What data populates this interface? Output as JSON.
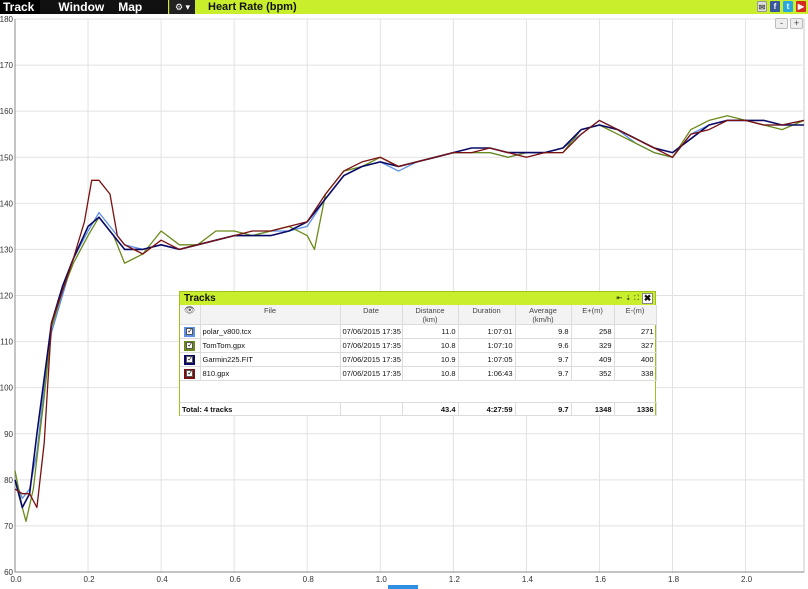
{
  "menu": {
    "track": "Track",
    "window": "Window",
    "map": "Map",
    "gear": "⚙ ▾"
  },
  "chart_title": "Heart Rate (bpm)",
  "zoom": {
    "minus": "-",
    "plus": "+"
  },
  "colors": {
    "accent": "#c8ee2c",
    "polar": "#5b8fe8",
    "tomtom": "#6b8a1a",
    "garmin": "#0a0a66",
    "suunto": "#7a1010"
  },
  "chart_data": {
    "type": "line",
    "title": "Heart Rate (bpm)",
    "xlim": [
      0.0,
      2.16
    ],
    "ylim": [
      60,
      180
    ],
    "xticks": [
      "0.0",
      "0.2",
      "0.4",
      "0.6",
      "0.8",
      "1.0",
      "1.2",
      "1.4",
      "1.6",
      "1.8",
      "2.0"
    ],
    "yticks": [
      "60",
      "70",
      "80",
      "90",
      "100",
      "110",
      "120",
      "130",
      "140",
      "150",
      "160",
      "170",
      "180"
    ],
    "grid": true,
    "series": [
      {
        "name": "polar_v800.tcx",
        "color": "#5b8fe8",
        "x": [
          0,
          0.02,
          0.04,
          0.06,
          0.08,
          0.1,
          0.13,
          0.16,
          0.2,
          0.23,
          0.27,
          0.3,
          0.35,
          0.4,
          0.45,
          0.5,
          0.55,
          0.6,
          0.65,
          0.7,
          0.75,
          0.8,
          0.85,
          0.9,
          0.95,
          1.0,
          1.05,
          1.1,
          1.15,
          1.2,
          1.25,
          1.3,
          1.35,
          1.4,
          1.45,
          1.5,
          1.55,
          1.6,
          1.65,
          1.7,
          1.75,
          1.8,
          1.85,
          1.9,
          1.95,
          2.0,
          2.05,
          2.1,
          2.16
        ],
        "y": [
          80,
          76,
          78,
          86,
          100,
          112,
          120,
          128,
          134,
          138,
          134,
          131,
          130,
          131,
          130,
          131,
          132,
          133,
          133,
          134,
          134,
          135,
          141,
          146,
          148,
          149,
          147,
          149,
          150,
          151,
          151,
          151,
          150,
          151,
          151,
          152,
          155,
          158,
          156,
          153,
          151,
          150,
          155,
          157,
          158,
          158,
          157,
          157,
          158
        ]
      },
      {
        "name": "TomTom.gpx",
        "color": "#6b8a1a",
        "x": [
          0,
          0.02,
          0.03,
          0.05,
          0.08,
          0.1,
          0.13,
          0.16,
          0.2,
          0.23,
          0.27,
          0.3,
          0.35,
          0.4,
          0.45,
          0.5,
          0.55,
          0.6,
          0.65,
          0.7,
          0.75,
          0.8,
          0.82,
          0.85,
          0.9,
          0.95,
          1.0,
          1.05,
          1.1,
          1.15,
          1.2,
          1.25,
          1.3,
          1.35,
          1.4,
          1.45,
          1.5,
          1.55,
          1.6,
          1.65,
          1.7,
          1.75,
          1.8,
          1.85,
          1.9,
          1.95,
          2.0,
          2.05,
          2.1,
          2.16
        ],
        "y": [
          82,
          74,
          71,
          78,
          98,
          113,
          121,
          127,
          133,
          137,
          133,
          127,
          129,
          134,
          131,
          131,
          134,
          134,
          133,
          134,
          135,
          133,
          130,
          142,
          147,
          148,
          150,
          148,
          149,
          150,
          151,
          151,
          151,
          150,
          151,
          151,
          151,
          156,
          157,
          155,
          153,
          151,
          150,
          156,
          158,
          159,
          158,
          157,
          156,
          158
        ]
      },
      {
        "name": "Garmin225.FIT",
        "color": "#0a0a66",
        "x": [
          0,
          0.02,
          0.04,
          0.06,
          0.08,
          0.1,
          0.13,
          0.16,
          0.2,
          0.23,
          0.27,
          0.3,
          0.35,
          0.4,
          0.45,
          0.5,
          0.55,
          0.6,
          0.65,
          0.7,
          0.75,
          0.8,
          0.85,
          0.9,
          0.95,
          1.0,
          1.05,
          1.1,
          1.15,
          1.2,
          1.25,
          1.3,
          1.35,
          1.4,
          1.45,
          1.5,
          1.55,
          1.6,
          1.65,
          1.7,
          1.75,
          1.8,
          1.85,
          1.9,
          1.95,
          2.0,
          2.05,
          2.1,
          2.16
        ],
        "y": [
          80,
          74,
          77,
          90,
          102,
          114,
          122,
          128,
          135,
          137,
          133,
          130,
          130,
          131,
          130,
          131,
          132,
          133,
          133,
          133,
          134,
          136,
          141,
          146,
          148,
          149,
          148,
          149,
          150,
          151,
          152,
          152,
          151,
          151,
          151,
          152,
          156,
          157,
          156,
          154,
          152,
          151,
          154,
          157,
          158,
          158,
          158,
          157,
          157
        ]
      },
      {
        "name": "810.gpx",
        "color": "#7a1010",
        "x": [
          0,
          0.02,
          0.04,
          0.06,
          0.08,
          0.1,
          0.13,
          0.16,
          0.19,
          0.21,
          0.23,
          0.26,
          0.28,
          0.3,
          0.35,
          0.4,
          0.45,
          0.5,
          0.55,
          0.6,
          0.65,
          0.7,
          0.75,
          0.8,
          0.85,
          0.9,
          0.95,
          1.0,
          1.05,
          1.1,
          1.15,
          1.2,
          1.25,
          1.3,
          1.35,
          1.4,
          1.45,
          1.5,
          1.55,
          1.6,
          1.65,
          1.7,
          1.75,
          1.8,
          1.85,
          1.9,
          1.95,
          2.0,
          2.05,
          2.1,
          2.16
        ],
        "y": [
          78,
          77,
          77,
          74,
          88,
          114,
          121,
          128,
          136,
          145,
          145,
          142,
          133,
          131,
          129,
          132,
          130,
          131,
          132,
          133,
          134,
          134,
          135,
          136,
          142,
          147,
          149,
          150,
          148,
          149,
          150,
          151,
          151,
          152,
          151,
          150,
          151,
          151,
          155,
          158,
          156,
          154,
          152,
          150,
          155,
          156,
          158,
          158,
          157,
          157,
          158
        ]
      }
    ]
  },
  "tracks_panel": {
    "title": "Tracks",
    "controls": [
      "⇤",
      "⇣",
      "⛶"
    ],
    "close": "✖",
    "headers": {
      "eye": "👁",
      "file": "File",
      "date": "Date",
      "distance": "Distance",
      "distance_unit": "(km)",
      "duration": "Duration",
      "average": "Average",
      "average_unit": "(km/h)",
      "eplus": "E+(m)",
      "eminus": "E-(m)"
    },
    "rows": [
      {
        "file": "polar_v800.tcx",
        "date": "07/06/2015 17:35",
        "distance": "11.0",
        "duration": "1:07:01",
        "average": "9.8",
        "eplus": "258",
        "eminus": "271",
        "color": "#5b8fe8"
      },
      {
        "file": "TomTom.gpx",
        "date": "07/06/2015 17:35",
        "distance": "10.8",
        "duration": "1:07:10",
        "average": "9.6",
        "eplus": "329",
        "eminus": "327",
        "color": "#6b8a1a"
      },
      {
        "file": "Garmin225.FIT",
        "date": "07/06/2015 17:35",
        "distance": "10.9",
        "duration": "1:07:05",
        "average": "9.7",
        "eplus": "409",
        "eminus": "400",
        "color": "#0a0a66"
      },
      {
        "file": "810.gpx",
        "date": "07/06/2015 17:35",
        "distance": "10.8",
        "duration": "1:06:43",
        "average": "9.7",
        "eplus": "352",
        "eminus": "338",
        "color": "#7a1010"
      }
    ],
    "total": {
      "label": "Total: 4 tracks",
      "distance": "43.4",
      "duration": "4:27:59",
      "average": "9.7",
      "eplus": "1348",
      "eminus": "1336"
    }
  }
}
